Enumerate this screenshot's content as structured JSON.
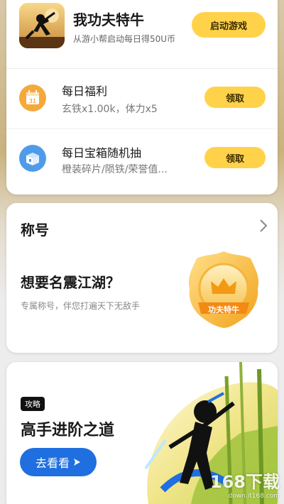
{
  "game": {
    "title": "我功夫特牛",
    "subtitle": "从游小帮启动每日得50U币",
    "launch_label": "启动游戏"
  },
  "daily_welfare": {
    "title": "每日福利",
    "subtitle": "玄铁x1.00k，体力x5",
    "calendar_number": "31",
    "claim_label": "领取"
  },
  "daily_chest": {
    "title": "每日宝箱随机抽",
    "subtitle": "橙装碎片/陨铁/荣誉值...",
    "claim_label": "领取"
  },
  "title_section": {
    "heading": "称号",
    "headline": "想要名震江湖？",
    "description": "专属称号，伴您打遍天下无敌手",
    "badge_text": "功夫特牛"
  },
  "guide_section": {
    "tag": "攻略",
    "title": "高手进阶之道",
    "button_label": "去看看"
  },
  "watermark": {
    "text": "168下载",
    "url": "down.it168.com"
  },
  "colors": {
    "accent_yellow": "#ffd24a",
    "accent_blue": "#1f6fe0"
  }
}
